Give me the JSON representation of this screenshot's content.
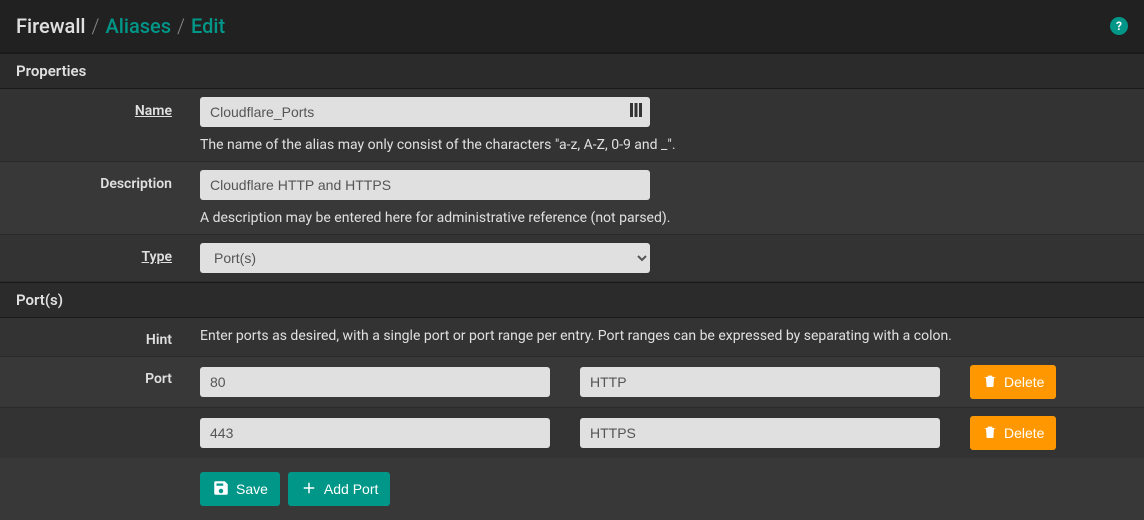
{
  "breadcrumb": {
    "root": "Firewall",
    "mid": "Aliases",
    "leaf": "Edit"
  },
  "panels": {
    "properties": "Properties",
    "ports": "Port(s)"
  },
  "labels": {
    "name": "Name",
    "description": "Description",
    "type": "Type",
    "hint": "Hint",
    "port": "Port"
  },
  "fields": {
    "name": {
      "value": "Cloudflare_Ports",
      "help": "The name of the alias may only consist of the characters \"a-z, A-Z, 0-9 and _\"."
    },
    "description": {
      "value": "Cloudflare HTTP and HTTPS",
      "help": "A description may be entered here for administrative reference (not parsed)."
    },
    "type": {
      "value": "Port(s)"
    },
    "hint": "Enter ports as desired, with a single port or port range per entry. Port ranges can be expressed by separating with a colon."
  },
  "ports": [
    {
      "value": "80",
      "desc": "HTTP"
    },
    {
      "value": "443",
      "desc": "HTTPS"
    }
  ],
  "buttons": {
    "delete": "Delete",
    "save": "Save",
    "addPort": "Add Port"
  }
}
